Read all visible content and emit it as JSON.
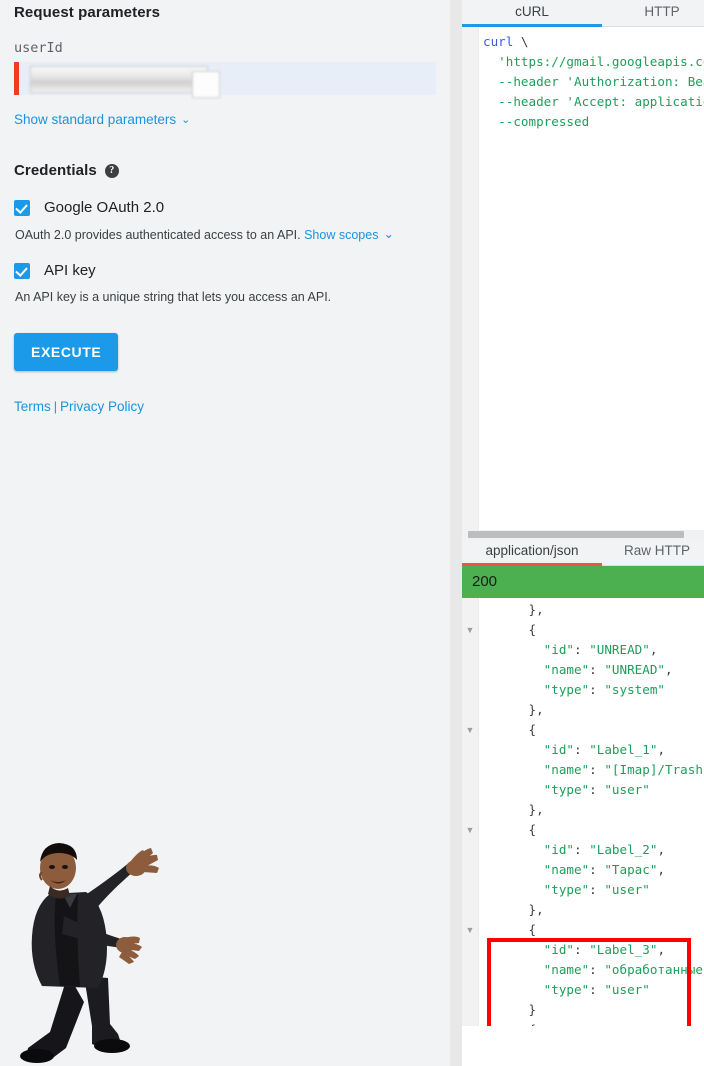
{
  "left": {
    "request_parameters_title": "Request parameters",
    "user_id_label": "userId",
    "user_id_value": "",
    "user_id_placeholder": "",
    "show_standard_parameters": "Show standard parameters",
    "chevron": "⌄",
    "credentials_title": "Credentials",
    "help_icon_glyph": "?",
    "credentials": [
      {
        "label": "Google OAuth 2.0",
        "checked": true,
        "description": "OAuth 2.0 provides authenticated access to an API.",
        "link": "Show scopes",
        "link_chevron": "⌄"
      },
      {
        "label": "API key",
        "checked": true,
        "description": "An API key is a unique string that lets you access an API.",
        "link": "",
        "link_chevron": ""
      }
    ],
    "execute_label": "EXECUTE",
    "terms_label": "Terms",
    "separator": "|",
    "privacy_label": "Privacy Policy"
  },
  "request_tabs": {
    "items": [
      {
        "label": "cURL",
        "active": true
      },
      {
        "label": "HTTP",
        "active": false
      }
    ]
  },
  "curl": {
    "lines": [
      [
        {
          "t": "curl",
          "c": "kw"
        },
        {
          "t": " \\",
          "c": "pun"
        }
      ],
      [
        {
          "t": "  'https://gmail.googleapis.com/g",
          "c": "str"
        }
      ],
      [
        {
          "t": "  --header 'Authorization: Bearer",
          "c": "str"
        }
      ],
      [
        {
          "t": "  --header 'Accept: application/j",
          "c": "str"
        }
      ],
      [
        {
          "t": "  --compressed",
          "c": "str"
        }
      ]
    ]
  },
  "response_tabs": {
    "items": [
      {
        "label": "application/json",
        "active": true
      },
      {
        "label": "Raw HTTP",
        "active": false
      }
    ]
  },
  "response": {
    "status_code": "200",
    "status_color": "#4caf50",
    "json_lines": [
      {
        "text": "      },",
        "fold": false
      },
      {
        "text": "      {",
        "fold": true
      },
      {
        "text": "        \"id\": \"UNREAD\",",
        "fold": false
      },
      {
        "text": "        \"name\": \"UNREAD\",",
        "fold": false
      },
      {
        "text": "        \"type\": \"system\"",
        "fold": false
      },
      {
        "text": "      },",
        "fold": false
      },
      {
        "text": "      {",
        "fold": true
      },
      {
        "text": "        \"id\": \"Label_1\",",
        "fold": false
      },
      {
        "text": "        \"name\": \"[Imap]/Trash\",",
        "fold": false
      },
      {
        "text": "        \"type\": \"user\"",
        "fold": false
      },
      {
        "text": "      },",
        "fold": false
      },
      {
        "text": "      {",
        "fold": true
      },
      {
        "text": "        \"id\": \"Label_2\",",
        "fold": false
      },
      {
        "text": "        \"name\": \"Тарас\",",
        "fold": false
      },
      {
        "text": "        \"type\": \"user\"",
        "fold": false
      },
      {
        "text": "      },",
        "fold": false
      },
      {
        "text": "      {",
        "fold": true
      },
      {
        "text": "        \"id\": \"Label_3\",",
        "fold": false
      },
      {
        "text": "        \"name\": \"обработанные\",",
        "fold": false
      },
      {
        "text": "        \"type\": \"user\"",
        "fold": false
      },
      {
        "text": "      }",
        "fold": false
      },
      {
        "text": "      {",
        "fold": false
      }
    ]
  },
  "annotation": {
    "highlight_color": "#ff0000",
    "highlight_target": "Label_3 object"
  },
  "colors": {
    "accent_blue": "#1a9ae8",
    "link_blue": "#1a94e0",
    "required_red": "#f03c26",
    "status_green": "#4caf50",
    "panel_bg": "#f1f3f4",
    "json_string": "#1e9e5a"
  }
}
